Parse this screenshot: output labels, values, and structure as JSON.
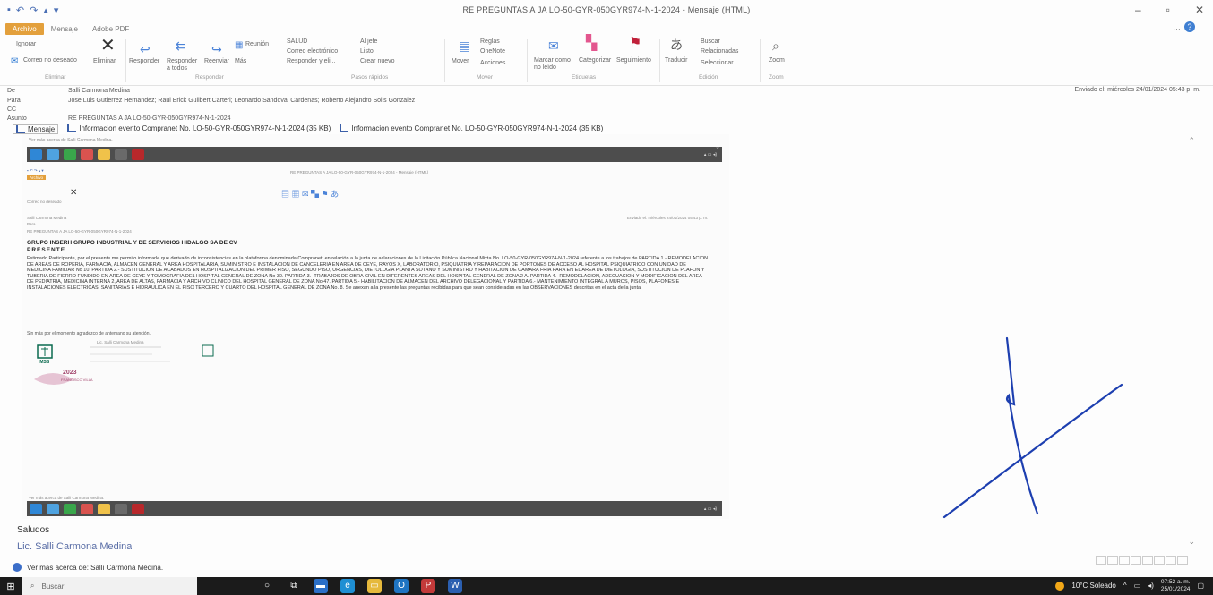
{
  "window": {
    "title": "RE PREGUNTAS A JA LO-50-GYR-050GYR974-N-1-2024 - Mensaje (HTML)",
    "minimize": "–",
    "maximize": "▫",
    "close": "✕"
  },
  "ribbon": {
    "tabs": [
      "Archivo",
      "Mensaje",
      "Adobe PDF"
    ],
    "buttons": {
      "ignorar": "Ignorar",
      "correo_no_deseado": "Correo no deseado",
      "eliminar": "Eliminar",
      "responder": "Responder",
      "responder_todos": "Responder a todos",
      "reenviar": "Reenviar",
      "mas": "Más",
      "reunion": "Reunión",
      "salud": "SALUD",
      "correo_electronico": "Correo electrónico",
      "responder_y_el": "Responder y eli...",
      "al_jefe": "Al jefe",
      "listo": "Listo",
      "crear_nuevo": "Crear nuevo",
      "mover": "Mover",
      "reglas": "Reglas",
      "onenote": "OneNote",
      "acciones": "Acciones",
      "marcar_no_leido": "Marcar como no leído",
      "categorizar": "Categorizar",
      "seguimiento": "Seguimiento",
      "traducir": "Traducir",
      "buscar": "Buscar",
      "relacionadas": "Relacionadas",
      "seleccionar": "Seleccionar",
      "zoom": "Zoom"
    },
    "groups": [
      "Eliminar",
      "Responder",
      "Pasos rápidos",
      "Mover",
      "Etiquetas",
      "Edición",
      "Zoom"
    ]
  },
  "headers": {
    "de_label": "De",
    "de_value": "Salli Carmona Medina",
    "para_label": "Para",
    "para_value": "Jose Luis Gutierrez Hernandez; Raul Erick Guilbert Carteri; Leonardo Sandoval Cardenas; Roberto Alejandro Solis Gonzalez",
    "cc_label": "CC",
    "asunto_label": "Asunto",
    "asunto_value": "RE PREGUNTAS A JA LO-50-GYR-050GYR974-N-1-2024",
    "enviado": "Enviado el:  miércoles 24/01/2024 05:43 p. m."
  },
  "attachments": [
    "Mensaje",
    "Informacion evento Compranet No. LO-50-GYR-050GYR974-N-1-2024 (35 KB)",
    "Informacion evento Compranet No. LO-50-GYR-050GYR974-N-1-2024 (35 KB)"
  ],
  "embedded": {
    "top_title": "Ver más acerca de Salli Carmona Medina.",
    "company": "GRUPO INSERH GRUPO INDUSTRIAL Y DE SERVICIOS HIDALGO SA DE CV",
    "presente": "PRESENTE",
    "body": "Estimado Participante, por el presente me permito informarle que derivado de inconsistencias en la plataforma denominada Compranet, en relación a la junta de aclaraciones de la Licitación Pública Nacional Mixta No. LO-50-GYR-050GYR974-N-1-2024 referente a los trabajos de PARTIDA 1.- REMODELACION DE AREAS DE ROPERIA, FARMACIA, ALMACEN GENERAL Y AREA HOSPITALARIA, SUMINISTRO E INSTALACION DE CANCELERIA EN AREA DE CEYE, RAYOS X, LABORATORIO, PSIQUIATRIA Y REPARACION DE PORTONES DE ACCESO AL HOSPITAL PSIQUIATRICO CON UNIDAD DE MEDICINA FAMILIAR No 10. PARTIDA 2.- SUSTITUCION DE ACABADOS EN HOSPITALIZACION DEL PRIMER PISO, SEGUNDO PISO, URGENCIAS, DIETOLOGIA PLANTA SOTANO Y SUMINISTRO Y HABITACION DE CAMARA FRIA PARA EN EL AREA DE DIETOLOGIA, SUSTITUCION DE PLAFON Y TUBERIA DE FIERRO FUNDIDO EN AREA DE CEYE Y TOMOGRAFIA DEL HOSPITAL GENERAL DE ZONA No 30. PARTIDA 3.- TRABAJOS DE OBRA CIVIL EN DIFERENTES AREAS DEL HOSPITAL GENERAL DE ZONA 2 A. PARTIDA 4.- REMODELACION, ADECUACION Y MODIFICACION DEL AREA DE PEDIATRIA, MEDICINA INTERNA 2, AREA DE ALTAS, FARMACIA Y ARCHIVO CLINICO DEL HOSPITAL GENERAL DE ZONA No 47. PARTIDA 5.- HABILITACION DE ALMACEN DEL ARCHIVO DELEGACIONAL Y PARTIDA 6.- MANTENIMIENTO INTEGRAL A MUROS, PISOS, PLAFONES E INSTALACIONES ELECTRICAS, SANITARIAS E HIDRAULICA EN EL PISO TERCERO Y CUARTO DEL HOSPITAL GENERAL DE ZONA No. 8. Se anexan a la presente las preguntas recibidas para que sean consideradas en las OBSERVACIONES descritas en el acta de la junta.",
    "closing": "Sin más por el momento agradezco de antemano su atención.",
    "sig_name": "Lic. Salli Carmona Medina",
    "sig_org": "IMSS",
    "sig_year": "2023",
    "sig_year_caption": "FRANCISCO VILLA"
  },
  "footer": {
    "saludos": "Saludos",
    "sig_name": "Lic. Salli Carmona Medina",
    "more_about": "Ver más acerca de: Salli Carmona Medina."
  },
  "taskbar": {
    "search_placeholder": "Buscar",
    "weather": "10°C  Soleado",
    "time": "07:52 a. m.",
    "date": "25/01/2024"
  },
  "colors": {
    "accent": "#e3a03c",
    "ink": "#1d3fb0",
    "taskbar": "#1b1b1b"
  }
}
